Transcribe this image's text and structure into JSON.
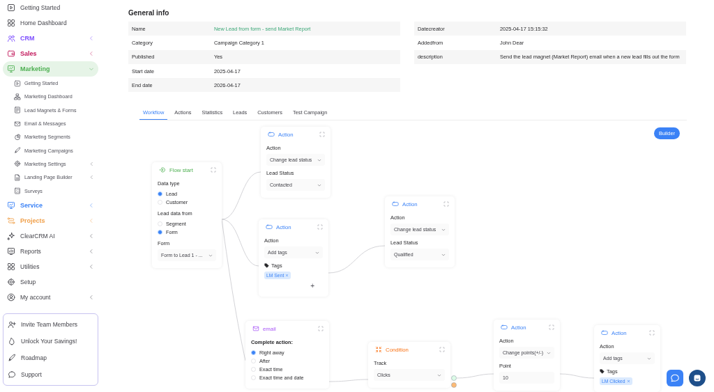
{
  "sidebar": {
    "items": [
      {
        "label": "Getting Started",
        "selected": false
      },
      {
        "label": "Home Dashboard",
        "selected": false
      },
      {
        "label": "CRM",
        "selected": false,
        "color": "#7c4dff",
        "expanded": false
      },
      {
        "label": "Sales",
        "selected": false,
        "color": "#c2185b",
        "expanded": false
      },
      {
        "label": "Marketing",
        "selected": true,
        "color": "#4caf50",
        "expanded": true,
        "children": [
          {
            "label": "Getting Started",
            "selected": false
          },
          {
            "label": "Marketing Dashboard",
            "selected": false
          },
          {
            "label": "Lead Magnets & Forms",
            "selected": false
          },
          {
            "label": "Email & Messages",
            "selected": false
          },
          {
            "label": "Marketing Segments",
            "selected": false
          },
          {
            "label": "Marketing Campaigns",
            "selected": false
          },
          {
            "label": "Marketing Settings",
            "selected": false,
            "expanded": false
          },
          {
            "label": "Landing Page Builder",
            "selected": false,
            "expanded": false
          },
          {
            "label": "Surveys",
            "selected": false
          }
        ]
      },
      {
        "label": "Service",
        "selected": false,
        "color": "#3b82f6",
        "expanded": false
      },
      {
        "label": "Projects",
        "selected": false,
        "color": "#f0a04b",
        "expanded": false
      },
      {
        "label": "ClearCRM AI",
        "selected": false,
        "expanded": false
      },
      {
        "label": "Reports",
        "selected": false,
        "expanded": false
      },
      {
        "label": "Utilities",
        "selected": false,
        "expanded": false
      },
      {
        "label": "Setup",
        "selected": false
      },
      {
        "label": "My account",
        "selected": false,
        "expanded": false
      }
    ],
    "footer_items": [
      {
        "label": "Invite Team Members"
      },
      {
        "label": "Unlock Your Savings!"
      },
      {
        "label": "Roadmap"
      },
      {
        "label": "Support"
      }
    ]
  },
  "general_info": {
    "title": "General info",
    "left_rows": [
      {
        "label": "Name",
        "value": "New Lead from form - send Market Report",
        "link": true
      },
      {
        "label": "Category",
        "value": "Campaign Category 1",
        "link": false
      },
      {
        "label": "Published",
        "value": "Yes",
        "link": false
      },
      {
        "label": "Start date",
        "value": "2025-04-17",
        "link": false
      },
      {
        "label": "End date",
        "value": "2026-04-17",
        "link": false
      }
    ],
    "right_rows": [
      {
        "label": "Datecreator",
        "value": "2025-04-17 15:15:32"
      },
      {
        "label": "Addedfrom",
        "value": "John Dear"
      },
      {
        "label": "description",
        "value": "Send the lead magnet (Market Report) email when a new lead fills out the form"
      }
    ]
  },
  "tabs": [
    {
      "label": "Workflow",
      "selected": true
    },
    {
      "label": "Actions",
      "selected": false
    },
    {
      "label": "Statistics",
      "selected": false
    },
    {
      "label": "Leads",
      "selected": false
    },
    {
      "label": "Customers",
      "selected": false
    },
    {
      "label": "Test Campaign",
      "selected": false
    }
  ],
  "builder_button": "Builder",
  "nodes": [
    {
      "kind": "start",
      "title": "Flow start",
      "fields": [
        {
          "kind": "label",
          "text": "Data type"
        },
        {
          "kind": "radio",
          "label": "Lead",
          "selected": true
        },
        {
          "kind": "radio",
          "label": "Customer",
          "selected": false
        },
        {
          "kind": "label",
          "text": "Lead data from"
        },
        {
          "kind": "radio",
          "label": "Segment",
          "selected": false
        },
        {
          "kind": "radio",
          "label": "Form",
          "selected": true
        },
        {
          "kind": "label",
          "text": "Form"
        },
        {
          "kind": "select",
          "value": "Form to Lead 1 - ..."
        }
      ]
    },
    {
      "kind": "action",
      "title": "Action",
      "fields": [
        {
          "kind": "label",
          "text": "Action"
        },
        {
          "kind": "select",
          "value": "Change lead status"
        },
        {
          "kind": "label",
          "text": "Lead Status"
        },
        {
          "kind": "select",
          "value": "Contacted"
        }
      ]
    },
    {
      "kind": "action",
      "title": "Action",
      "fields": [
        {
          "kind": "label",
          "text": "Action"
        },
        {
          "kind": "select",
          "value": "Add tags"
        },
        {
          "kind": "tags",
          "label": "Tags",
          "tags": [
            "LM Sent"
          ]
        },
        {
          "kind": "add",
          "text": "+"
        }
      ]
    },
    {
      "kind": "action",
      "title": "Action",
      "fields": [
        {
          "kind": "label",
          "text": "Action"
        },
        {
          "kind": "select",
          "value": "Change lead status"
        },
        {
          "kind": "label",
          "text": "Lead Status"
        },
        {
          "kind": "select",
          "value": "Qualified"
        }
      ]
    },
    {
      "kind": "email",
      "title": "email",
      "fields": [
        {
          "kind": "heading",
          "text": "Complete action:"
        },
        {
          "kind": "radio",
          "label": "Right away",
          "selected": true
        },
        {
          "kind": "radio",
          "label": "After",
          "selected": false
        },
        {
          "kind": "radio",
          "label": "Exact time",
          "selected": false
        },
        {
          "kind": "radio",
          "label": "Exact time and date",
          "selected": false
        }
      ]
    },
    {
      "kind": "condition",
      "title": "Condition",
      "fields": [
        {
          "kind": "label",
          "text": "Track"
        },
        {
          "kind": "select",
          "value": "Clicks"
        }
      ]
    },
    {
      "kind": "action",
      "title": "Action",
      "fields": [
        {
          "kind": "label",
          "text": "Action"
        },
        {
          "kind": "select",
          "value": "Change points(+/-)"
        },
        {
          "kind": "label",
          "text": "Point"
        },
        {
          "kind": "input",
          "value": "10"
        }
      ]
    },
    {
      "kind": "action",
      "title": "Action",
      "fields": [
        {
          "kind": "label",
          "text": "Action"
        },
        {
          "kind": "select",
          "value": "Add tags"
        },
        {
          "kind": "tags",
          "label": "Tags",
          "tags": [
            "LM Clicked"
          ]
        }
      ]
    }
  ]
}
